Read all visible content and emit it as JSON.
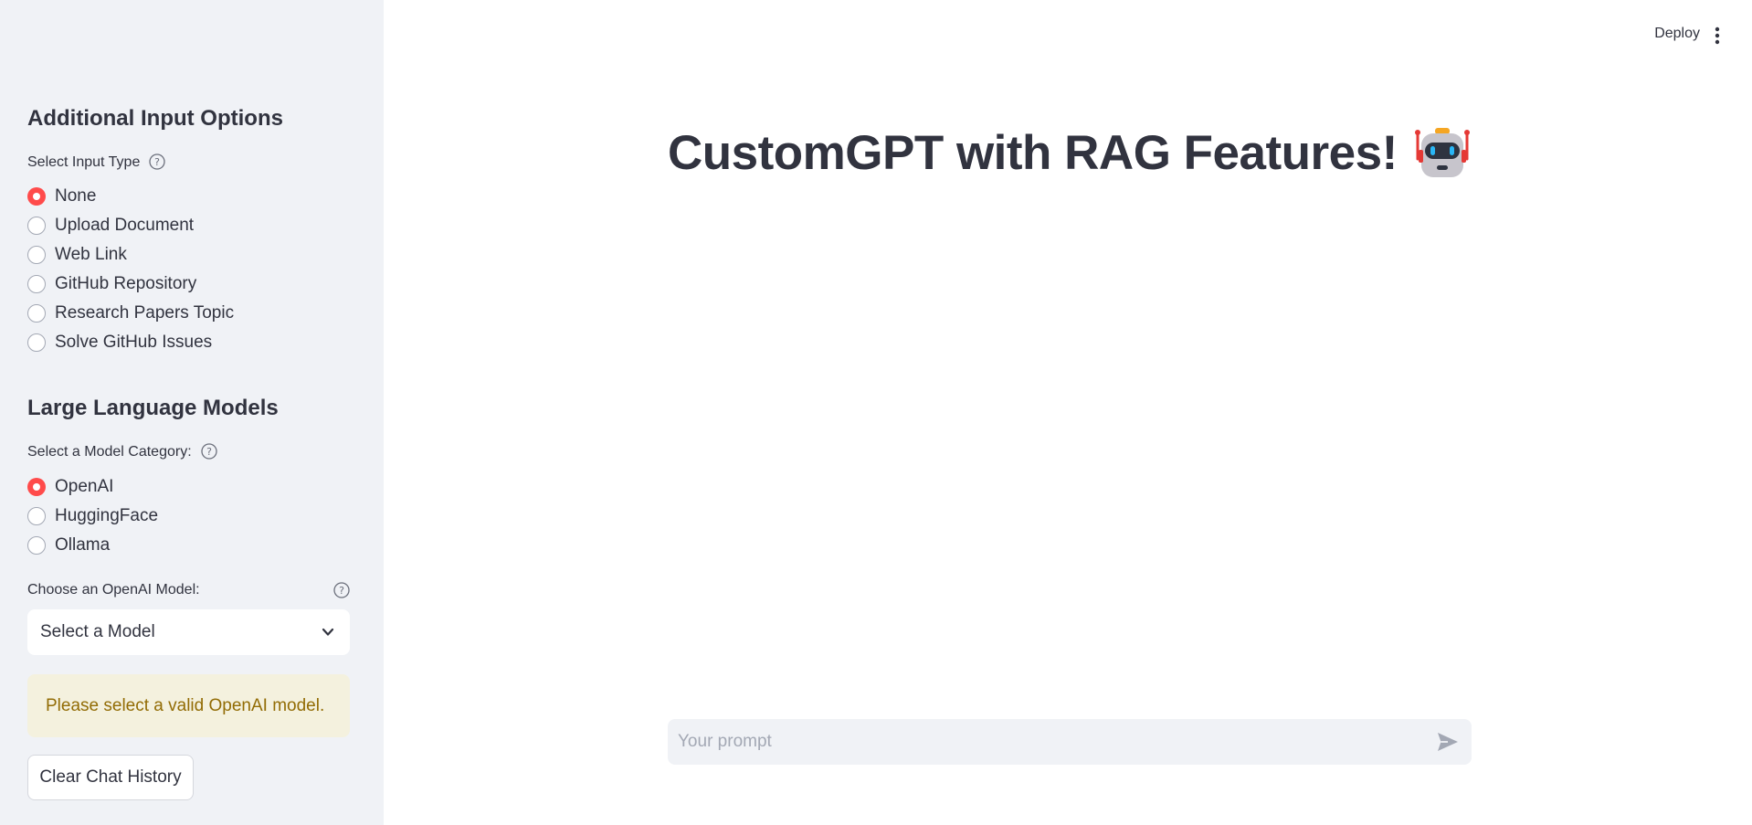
{
  "sidebar": {
    "input_options": {
      "header": "Additional Input Options",
      "label": "Select Input Type",
      "selected": 0,
      "options": [
        "None",
        "Upload Document",
        "Web Link",
        "GitHub Repository",
        "Research Papers Topic",
        "Solve GitHub Issues"
      ]
    },
    "llm": {
      "header": "Large Language Models",
      "label": "Select a Model Category:",
      "selected": 0,
      "options": [
        "OpenAI",
        "HuggingFace",
        "Ollama"
      ]
    },
    "model_select": {
      "label": "Choose an OpenAI Model:",
      "value": "Select a Model"
    },
    "warning": "Please select a valid OpenAI model.",
    "clear_button": "Clear Chat History"
  },
  "header": {
    "deploy_label": "Deploy",
    "menu_icon": "more-vertical-icon"
  },
  "main": {
    "title": "CustomGPT with RAG Features!",
    "title_emoji": "robot-icon",
    "chat": {
      "placeholder": "Your prompt",
      "send_icon": "send-icon"
    }
  },
  "colors": {
    "accent": "#ff4b4b",
    "sidebar_bg": "#f0f2f6",
    "text": "#31333f",
    "warning_bg": "#f4f1de",
    "warning_text": "#926c05"
  }
}
